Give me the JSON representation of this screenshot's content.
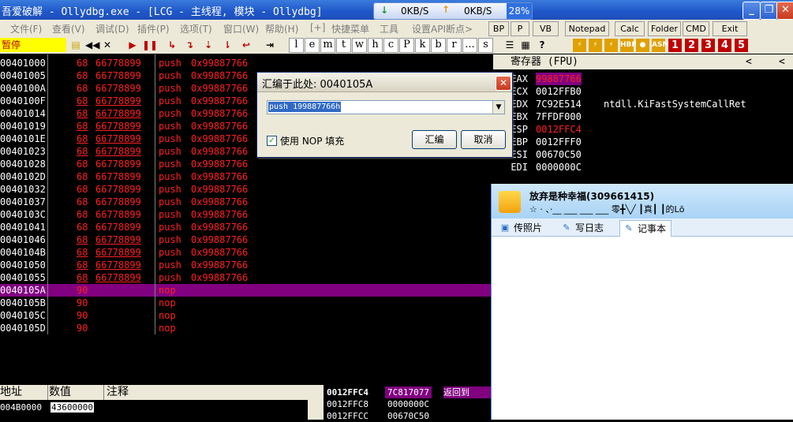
{
  "title": "吾爱破解 - Ollydbg.exe - [LCG - 主线程, 模块 - Ollydbg]",
  "net": {
    "down_label": "0KB/S",
    "up_label": "0KB/S",
    "percent": "28%"
  },
  "window_buttons": {
    "minimize": "_",
    "restore": "❐",
    "close": "✕"
  },
  "menu": [
    "文件(F)",
    "查看(V)",
    "调试(D)",
    "插件(P)",
    "选项(T)",
    "窗口(W)",
    "帮助(H)",
    "[+]",
    "快捷菜单",
    "工具",
    "设置API断点>"
  ],
  "toolbar_buttons": [
    "BP",
    "P",
    "VB",
    "Notepad",
    "Calc",
    "Folder",
    "CMD",
    "Exit"
  ],
  "status": "暂停",
  "letters": [
    "l",
    "e",
    "m",
    "t",
    "w",
    "h",
    "c",
    "P",
    "k",
    "b",
    "r",
    "...",
    "s"
  ],
  "disasm": [
    {
      "addr": "00401000",
      "hp": "68",
      "hv": "66778899",
      "m": "push",
      "o": "0x99887766",
      "ul": false
    },
    {
      "addr": "00401005",
      "hp": "68",
      "hv": "66778899",
      "m": "push",
      "o": "0x99887766",
      "ul": false
    },
    {
      "addr": "0040100A",
      "hp": "68",
      "hv": "66778899",
      "m": "push",
      "o": "0x99887766",
      "ul": false
    },
    {
      "addr": "0040100F",
      "hp": "68",
      "hv": "66778899",
      "m": "push",
      "o": "0x99887766",
      "ul": true
    },
    {
      "addr": "00401014",
      "hp": "68",
      "hv": "66778899",
      "m": "push",
      "o": "0x99887766",
      "ul": true
    },
    {
      "addr": "00401019",
      "hp": "68",
      "hv": "66778899",
      "m": "push",
      "o": "0x99887766",
      "ul": true
    },
    {
      "addr": "0040101E",
      "hp": "68",
      "hv": "66778899",
      "m": "push",
      "o": "0x99887766",
      "ul": true
    },
    {
      "addr": "00401023",
      "hp": "68",
      "hv": "66778899",
      "m": "push",
      "o": "0x99887766",
      "ul": true
    },
    {
      "addr": "00401028",
      "hp": "68",
      "hv": "66778899",
      "m": "push",
      "o": "0x99887766",
      "ul": false
    },
    {
      "addr": "0040102D",
      "hp": "68",
      "hv": "66778899",
      "m": "push",
      "o": "0x99887766",
      "ul": false
    },
    {
      "addr": "00401032",
      "hp": "68",
      "hv": "66778899",
      "m": "push",
      "o": "0x99887766",
      "ul": false
    },
    {
      "addr": "00401037",
      "hp": "68",
      "hv": "66778899",
      "m": "push",
      "o": "0x99887766",
      "ul": false
    },
    {
      "addr": "0040103C",
      "hp": "68",
      "hv": "66778899",
      "m": "push",
      "o": "0x99887766",
      "ul": false
    },
    {
      "addr": "00401041",
      "hp": "68",
      "hv": "66778899",
      "m": "push",
      "o": "0x99887766",
      "ul": false
    },
    {
      "addr": "00401046",
      "hp": "68",
      "hv": "66778899",
      "m": "push",
      "o": "0x99887766",
      "ul": true
    },
    {
      "addr": "0040104B",
      "hp": "68",
      "hv": "66778899",
      "m": "push",
      "o": "0x99887766",
      "ul": true
    },
    {
      "addr": "00401050",
      "hp": "68",
      "hv": "66778899",
      "m": "push",
      "o": "0x99887766",
      "ul": true
    },
    {
      "addr": "00401055",
      "hp": "68",
      "hv": "66778899",
      "m": "push",
      "o": "0x99887766",
      "ul": true
    },
    {
      "addr": "0040105A",
      "hp": "90",
      "hv": "",
      "m": "nop",
      "o": "",
      "ul": false,
      "sel": true
    },
    {
      "addr": "0040105B",
      "hp": "90",
      "hv": "",
      "m": "nop",
      "o": "",
      "ul": false
    },
    {
      "addr": "0040105C",
      "hp": "90",
      "hv": "",
      "m": "nop",
      "o": "",
      "ul": false
    },
    {
      "addr": "0040105D",
      "hp": "90",
      "hv": "",
      "m": "nop",
      "o": "",
      "ul": false
    }
  ],
  "registers": {
    "header": "寄存器 (FPU)",
    "rows": [
      {
        "n": "EAX",
        "v": "99887766",
        "c": "",
        "hl": true
      },
      {
        "n": "ECX",
        "v": "0012FFB0",
        "c": "",
        "hl": false
      },
      {
        "n": "EDX",
        "v": "7C92E514",
        "c": "ntdll.KiFastSystemCallRet",
        "hl": false
      },
      {
        "n": "EBX",
        "v": "7FFDF000",
        "c": "",
        "hl": false
      },
      {
        "n": "ESP",
        "v": "0012FFC4",
        "c": "",
        "hl": false,
        "red": true
      },
      {
        "n": "EBP",
        "v": "0012FFF0",
        "c": "",
        "hl": false
      },
      {
        "n": "ESI",
        "v": "00670C50",
        "c": "",
        "hl": false
      },
      {
        "n": "EDI",
        "v": "0000000C",
        "c": "",
        "hl": false
      }
    ]
  },
  "dialog": {
    "title": "汇编于此处: 0040105A",
    "input": "push 199887766h",
    "checkbox": "使用 NOP 填充",
    "assemble": "汇编",
    "cancel": "取消"
  },
  "qq": {
    "name": "放弃是种幸福(309661415)",
    "signature": "☆ ·  、·__ ___ ___ ___ 零╋╲╱ ┃真┃ ┃的Lō",
    "tabs": [
      "传照片",
      "写日志",
      "记事本"
    ]
  },
  "dump": {
    "headers": [
      "地址",
      "数值",
      "注释"
    ],
    "rows": [
      {
        "a": "004B0000",
        "v": "43600000"
      }
    ]
  },
  "stack": {
    "rows": [
      {
        "a": "0012FFC4",
        "v": "7C817077",
        "c": "返回到",
        "sel": true
      },
      {
        "a": "0012FFC8",
        "v": "0000000C",
        "c": ""
      },
      {
        "a": "0012FFCC",
        "v": "00670C50",
        "c": ""
      }
    ]
  },
  "colors": {
    "accent": "#800080",
    "red": "#ff2020",
    "yellow": "#ffff00"
  }
}
